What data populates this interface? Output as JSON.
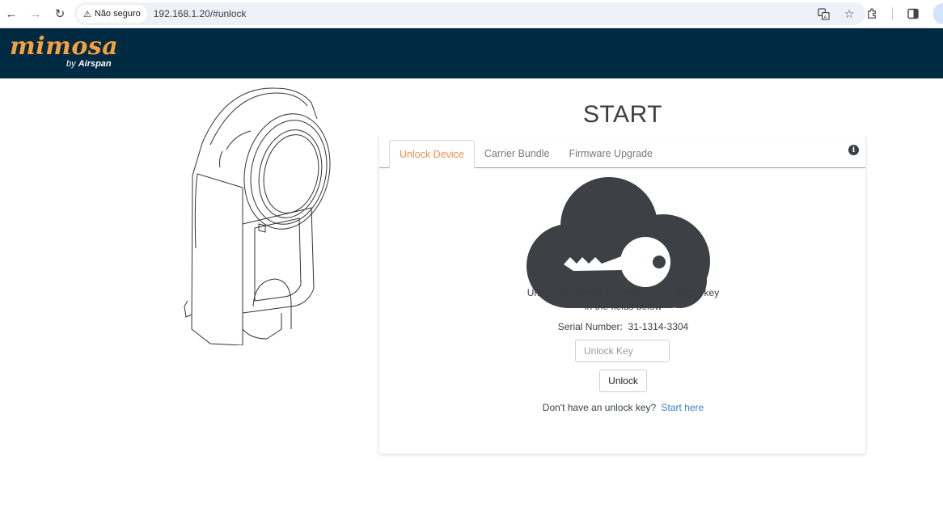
{
  "browser": {
    "security_label": "Não seguro",
    "url": "192.168.1.20/#unlock",
    "icons": [
      "back-arrow-icon",
      "forward-arrow-icon",
      "reload-icon",
      "warning-icon",
      "translate-icon",
      "star-icon",
      "extensions-icon",
      "side-panel-icon"
    ]
  },
  "header": {
    "logo_main": "mimosa",
    "logo_by": "by",
    "logo_brand": "Airspan",
    "bg_color": "#002a42",
    "logo_color": "#f4a03d"
  },
  "page": {
    "title": "START",
    "tabs": [
      {
        "label": "Unlock Device",
        "active": true
      },
      {
        "label": "Carrier Bundle",
        "active": false
      },
      {
        "label": "Firmware Upgrade",
        "active": false
      }
    ],
    "accent_color": "#f08f4b",
    "description_line1": "Unlock the device by entering the unlock key",
    "description_line2": "in the fields below",
    "serial_label": "Serial Number:",
    "serial_value": "31-1314-3304",
    "unlock_key_placeholder": "Unlock Key",
    "unlock_button": "Unlock",
    "no_key_text": "Don't have an unlock key?",
    "start_here_link": "Start here",
    "link_color": "#3a7fc1"
  }
}
